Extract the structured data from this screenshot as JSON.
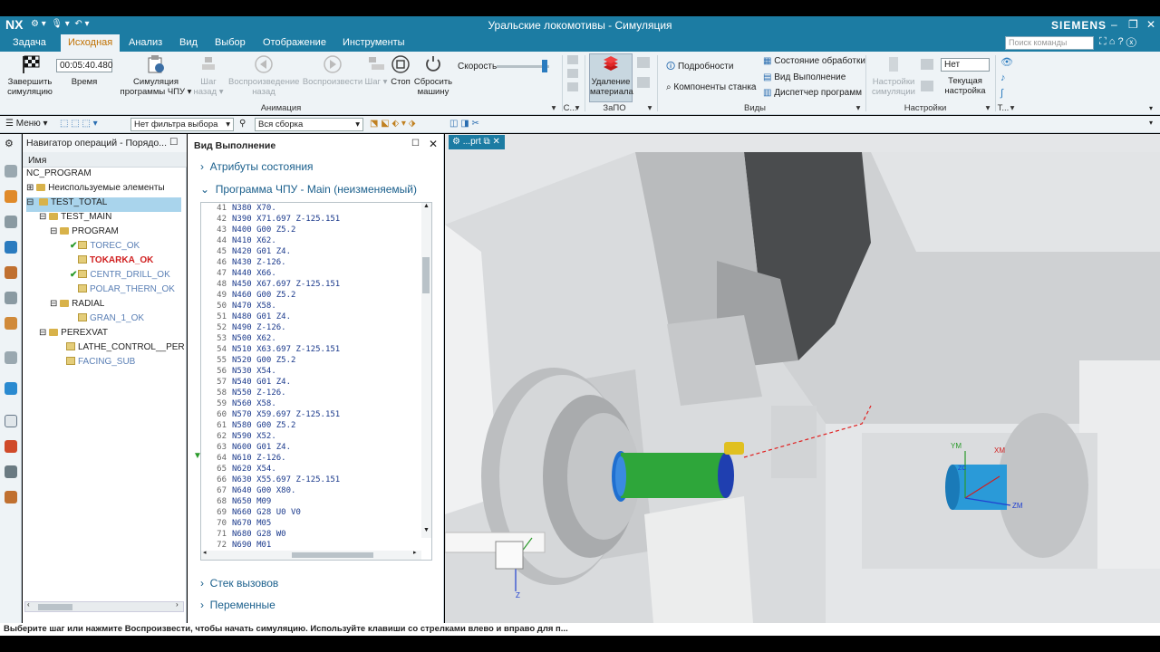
{
  "titlebar": {
    "app": "NX",
    "title": "Уральские локомотивы - Симуляция",
    "brand": "SIEMENS"
  },
  "menu": [
    "Задача",
    "Исходная",
    "Анализ",
    "Вид",
    "Выбор",
    "Отображение",
    "Инструменты"
  ],
  "search": {
    "placeholder": "Поиск команды"
  },
  "ribbon": {
    "finish": "Завершить симуляцию",
    "time_value": "00:05:40.480",
    "time_label": "Время",
    "sim_nc": "Симуляция программы ЧПУ",
    "step_back": "Шаг назад",
    "play_back": "Воспроизведение назад",
    "play": "Воспроизвести",
    "step": "Шаг",
    "stop": "Стоп",
    "reset": "Сбросить машину",
    "speed": "Скорость",
    "animation": "Анимация",
    "c_group": "С...",
    "remove_material": "Удаление материала",
    "zapo": "ЗаПО",
    "details": "Подробности",
    "components": "Компоненты станка",
    "proc_state": "Состояние обработки",
    "exec_view": "Вид Выполнение",
    "prog_mgr": "Диспетчер программ",
    "views": "Виды",
    "settings_sim": "Настройки симуляции",
    "none_value": "Нет",
    "cur_setup": "Текущая настройка",
    "settings": "Настройки",
    "t_group": "Т..."
  },
  "toolbar2": {
    "menu": "Меню",
    "filter": "Нет фильтра выбора",
    "assembly": "Вся сборка"
  },
  "navigator": {
    "title": "Навигатор операций - Порядо...",
    "column": "Имя",
    "items": [
      {
        "label": "NC_PROGRAM"
      },
      {
        "label": "Неиспользуемые элементы"
      },
      {
        "label": "TEST_TOTAL"
      },
      {
        "label": "TEST_MAIN"
      },
      {
        "label": "PROGRAM"
      },
      {
        "label": "TOREC_OK"
      },
      {
        "label": "TOKARKA_OK"
      },
      {
        "label": "CENTR_DRILL_OK"
      },
      {
        "label": "POLAR_THERN_OK"
      },
      {
        "label": "RADIAL"
      },
      {
        "label": "GRAN_1_OK"
      },
      {
        "label": "PEREXVAT"
      },
      {
        "label": "LATHE_CONTROL__PEREX"
      },
      {
        "label": "FACING_SUB"
      }
    ]
  },
  "exec": {
    "title": "Вид Выполнение",
    "attrs": "Атрибуты состояния",
    "program": "Программа ЧПУ - Main (неизменяемый)",
    "stack": "Стек вызовов",
    "vars": "Переменные",
    "lines": [
      {
        "n": "41",
        "c": "N380 X70."
      },
      {
        "n": "42",
        "c": "N390 X71.697 Z-125.151"
      },
      {
        "n": "43",
        "c": "N400 G00 Z5.2"
      },
      {
        "n": "44",
        "c": "N410 X62."
      },
      {
        "n": "45",
        "c": "N420 G01 Z4."
      },
      {
        "n": "46",
        "c": "N430 Z-126."
      },
      {
        "n": "47",
        "c": "N440 X66."
      },
      {
        "n": "48",
        "c": "N450 X67.697 Z-125.151"
      },
      {
        "n": "49",
        "c": "N460 G00 Z5.2"
      },
      {
        "n": "50",
        "c": "N470 X58."
      },
      {
        "n": "51",
        "c": "N480 G01 Z4."
      },
      {
        "n": "52",
        "c": "N490 Z-126."
      },
      {
        "n": "53",
        "c": "N500 X62."
      },
      {
        "n": "54",
        "c": "N510 X63.697 Z-125.151"
      },
      {
        "n": "55",
        "c": "N520 G00 Z5.2"
      },
      {
        "n": "56",
        "c": "N530 X54."
      },
      {
        "n": "57",
        "c": "N540 G01 Z4."
      },
      {
        "n": "58",
        "c": "N550 Z-126."
      },
      {
        "n": "59",
        "c": "N560 X58."
      },
      {
        "n": "60",
        "c": "N570 X59.697 Z-125.151"
      },
      {
        "n": "61",
        "c": "N580 G00 Z5.2"
      },
      {
        "n": "62",
        "c": "N590 X52."
      },
      {
        "n": "63",
        "c": "N600 G01 Z4."
      },
      {
        "n": "64",
        "c": "N610 Z-126."
      },
      {
        "n": "65",
        "c": "N620 X54."
      },
      {
        "n": "66",
        "c": "N630 X55.697 Z-125.151"
      },
      {
        "n": "67",
        "c": "N640 G00 X80."
      },
      {
        "n": "68",
        "c": "N650 M09"
      },
      {
        "n": "69",
        "c": "N660 G28 U0 V0"
      },
      {
        "n": "70",
        "c": "N670 M05"
      },
      {
        "n": "71",
        "c": "N680 G28 W0"
      },
      {
        "n": "72",
        "c": "N690 M01"
      }
    ]
  },
  "viewport": {
    "tab": "...prt",
    "axes": [
      "YM",
      "XM",
      "ZM",
      "ZC",
      "Z"
    ]
  },
  "status": "Выберите шаг или нажмите Воспроизвести, чтобы начать симуляцию. Используйте клавиши со стрелками влево и вправо для п...",
  "colors": {
    "accent": "#1c7ca3",
    "selected": "#a9d4ec"
  }
}
